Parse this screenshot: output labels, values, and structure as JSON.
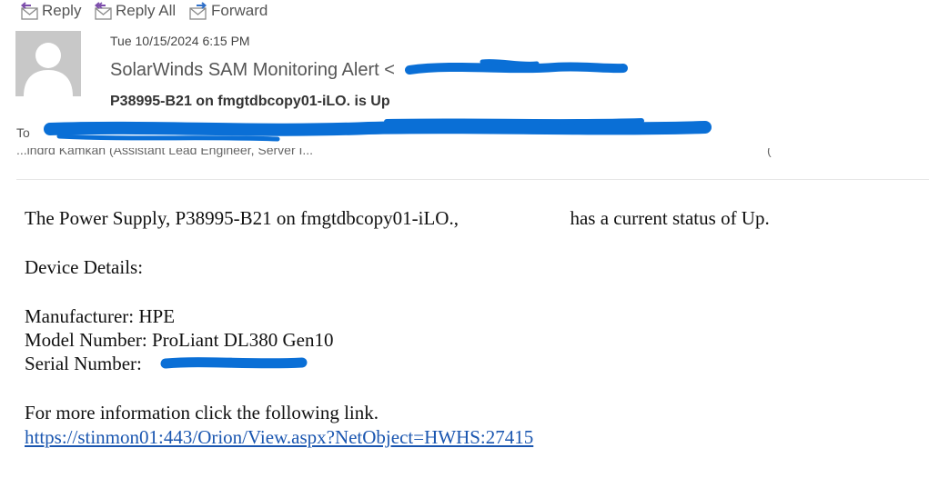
{
  "toolbar": {
    "reply_label": "Reply",
    "reply_all_label": "Reply All",
    "forward_label": "Forward"
  },
  "header": {
    "date": "Tue 10/15/2024 6:15 PM",
    "sender_prefix": "SolarWinds SAM Monitoring Alert <",
    "subject": "P38995-B21 on fmgtdbcopy01-iLO. is Up",
    "to_label": "To",
    "cc_visible_fragment": "...indrd Kamkan (Assistant Lead Engineer, Server I...",
    "cc_trailing_glyph": "("
  },
  "body": {
    "line1_prefix": "The Power Supply, P38995-B21 on fmgtdbcopy01-iLO.,",
    "line1_suffix": "has a current status of Up.",
    "device_details": "Device Details:",
    "manufacturer": "Manufacturer: HPE",
    "model": "Model Number: ProLiant DL380 Gen10",
    "serial_label": "Serial Number:",
    "more_info": "For more information click the following link.",
    "link": "https://stinmon01:443/Orion/View.aspx?NetObject=HWHS:27415"
  },
  "colors": {
    "redaction": "#0a6fd6",
    "link": "#1a56b0",
    "reply_icon_arrow": "#7c4dab",
    "forward_icon_arrow": "#2f6fc8"
  },
  "icons": {
    "reply": "reply-envelope-icon",
    "reply_all": "reply-all-envelope-icon",
    "forward": "forward-envelope-icon",
    "avatar": "person-silhouette-icon"
  }
}
